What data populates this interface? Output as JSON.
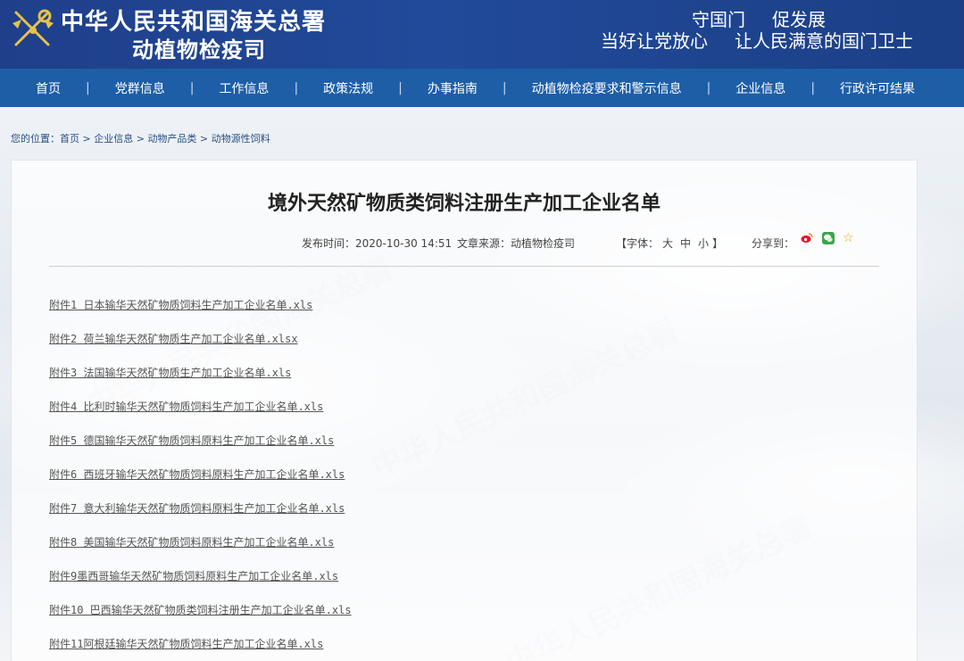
{
  "header": {
    "title_main": "中华人民共和国海关总署",
    "title_sub": "动植物检疫司",
    "slogan_1a": "守国门",
    "slogan_1b": "促发展",
    "slogan_2a": "当好让党放心",
    "slogan_2b": "让人民满意的国门卫士"
  },
  "nav": {
    "items": [
      "首页",
      "党群信息",
      "工作信息",
      "政策法规",
      "办事指南",
      "动植物检疫要求和警示信息",
      "企业信息",
      "行政许可结果"
    ]
  },
  "breadcrumb": {
    "prefix": "您的位置：",
    "items": [
      "首页",
      "企业信息",
      "动物产品类",
      "动物源性饲料"
    ],
    "sep": " > "
  },
  "article": {
    "title": "境外天然矿物质类饲料注册生产加工企业名单",
    "publish": "发布时间：2020-10-30 14:51",
    "source": "文章来源：动植物检疫司",
    "font_label_open": "【字体：",
    "font_big": "大",
    "font_mid": "中",
    "font_small": "小",
    "font_label_close": "】",
    "share_label": "分享到："
  },
  "attachments": [
    "附件1 日本输华天然矿物质饲料生产加工企业名单.xls",
    "附件2 荷兰输华天然矿物质生产加工企业名单.xlsx",
    "附件3 法国输华天然矿物质生产加工企业名单.xls",
    "附件4 比利时输华天然矿物质饲料生产加工企业名单.xls",
    "附件5 德国输华天然矿物质饲料原料生产加工企业名单.xls",
    "附件6 西班牙输华天然矿物质饲料原料生产加工企业名单.xls",
    "附件7 意大利输华天然矿物质饲料原料生产加工企业名单.xls",
    "附件8 美国输华天然矿物质饲料原料生产加工企业名单.xls",
    "附件9墨西哥输华天然矿物质饲料原料生产加工企业名单.xls",
    "附件10 巴西输华天然矿物质类饲料注册生产加工企业名单.xls",
    "附件11阿根廷输华天然矿物质饲料生产加工企业名单.xls"
  ],
  "colors": {
    "header_bg": "#1f3f8a",
    "nav_bg": "#1d5ea7",
    "breadcrumb": "#2a4e84"
  }
}
